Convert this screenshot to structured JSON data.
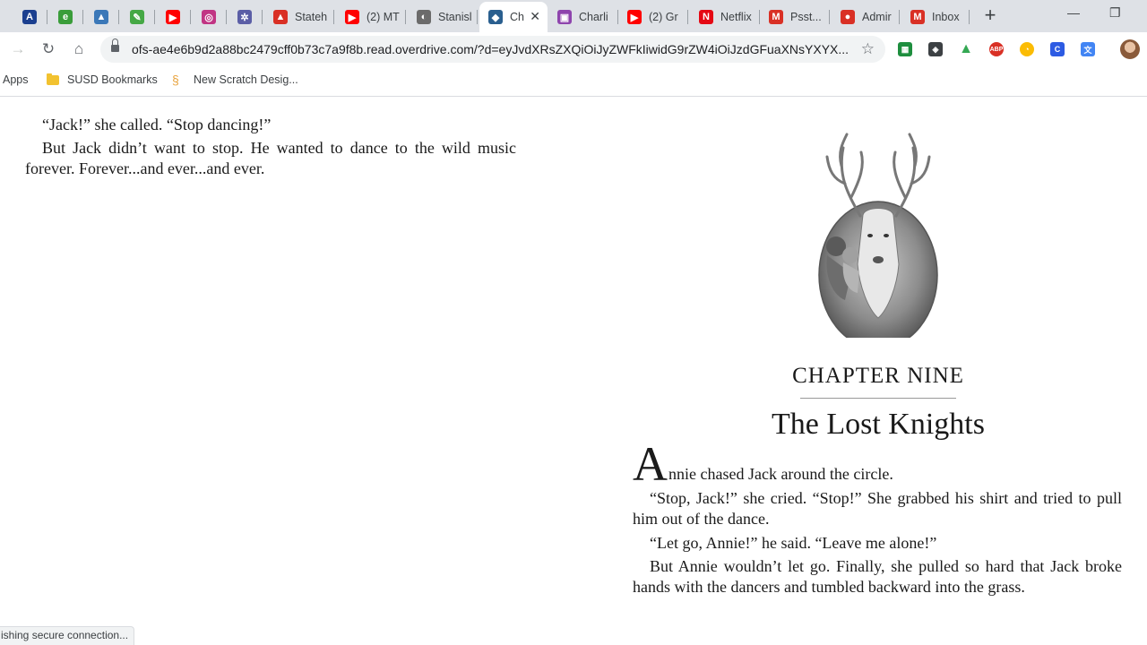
{
  "tabs": [
    {
      "title": "",
      "favicon": "adobe-icon",
      "color": "#1b3f8f",
      "glyph": "A"
    },
    {
      "title": "",
      "favicon": "grammar-icon",
      "color": "#3a9d3a",
      "glyph": "e"
    },
    {
      "title": "",
      "favicon": "python-icon",
      "color": "#3b78b8",
      "glyph": "▲"
    },
    {
      "title": "",
      "favicon": "leaf-icon",
      "color": "#45a845",
      "glyph": "✎"
    },
    {
      "title": "",
      "favicon": "youtube-icon",
      "color": "#ff0000",
      "glyph": "▶"
    },
    {
      "title": "",
      "favicon": "instagram-icon",
      "color": "#c13584",
      "glyph": "◎"
    },
    {
      "title": "",
      "favicon": "flower-icon",
      "color": "#5b5ea6",
      "glyph": "✲"
    },
    {
      "title": "Stateh",
      "favicon": "apple-icon",
      "color": "#d93025",
      "glyph": "▲"
    },
    {
      "title": "(2) MT",
      "favicon": "youtube-icon",
      "color": "#ff0000",
      "glyph": "▶"
    },
    {
      "title": "Stanisl",
      "favicon": "shield-icon",
      "color": "#6b6b6b",
      "glyph": "◐"
    },
    {
      "title": "Ch",
      "favicon": "overdrive-icon",
      "color": "#2a5f8f",
      "glyph": "◆",
      "active": true
    },
    {
      "title": "Charli",
      "favicon": "book-cover-icon",
      "color": "#8e44ad",
      "glyph": "▣"
    },
    {
      "title": "(2) Gr",
      "favicon": "youtube-icon",
      "color": "#ff0000",
      "glyph": "▶"
    },
    {
      "title": "Netflix",
      "favicon": "netflix-icon",
      "color": "#e50914",
      "glyph": "N"
    },
    {
      "title": "Psst...",
      "favicon": "gmail-icon",
      "color": "#d93025",
      "glyph": "M"
    },
    {
      "title": "Admir",
      "favicon": "record-icon",
      "color": "#d93025",
      "glyph": "●"
    },
    {
      "title": "Inbox",
      "favicon": "gmail-icon",
      "color": "#d93025",
      "glyph": "M"
    }
  ],
  "address_bar": {
    "url": "ofs-ae4e6b9d2a88bc2479cff0b73c7a9f8b.read.overdrive.com/?d=eyJvdXRsZXQiOiJyZWFkIiwidG9rZW4iOiJzdGFuaXNsYXYX..."
  },
  "bookmarks": {
    "items": [
      {
        "label": "Apps"
      },
      {
        "label": "SUSD Bookmarks"
      },
      {
        "label": "New Scratch Desig..."
      }
    ]
  },
  "book": {
    "left_page": [
      "“Jack!” she called. “Stop dancing!”",
      "But Jack didn’t want to stop. He wanted to dance to the wild music forever. Forever...and ever...and ever."
    ],
    "chapter_number": "CHAPTER NINE",
    "chapter_title": "The Lost Knights",
    "drop_cap": "A",
    "first_line_rest": "nnie chased Jack around the circle.",
    "right_page": [
      "“Stop, Jack!” she cried. “Stop!” She grabbed his shirt and tried to pull him out of the dance.",
      "“Let go, Annie!” he said. “Leave me alone!”",
      "But Annie wouldn’t let go. Finally, she pulled so hard that Jack broke hands with the dancers and tumbled backward into the grass."
    ]
  },
  "status_bar": {
    "text": "ishing secure connection..."
  },
  "colors": {
    "tab_strip": "#dee1e6",
    "omnibox": "#f1f3f4"
  }
}
